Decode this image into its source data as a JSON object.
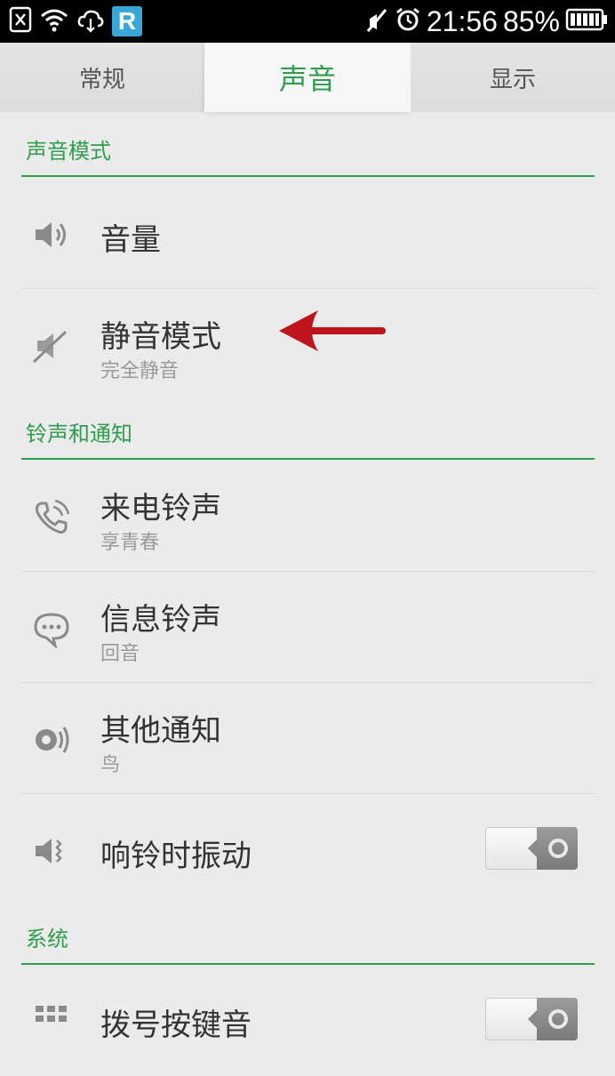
{
  "status_bar": {
    "time": "21:56",
    "battery": "85%",
    "app_badge": "R"
  },
  "tabs": [
    {
      "label": "常规",
      "active": false
    },
    {
      "label": "声音",
      "active": true
    },
    {
      "label": "显示",
      "active": false
    }
  ],
  "sections": {
    "sound_mode": "声音模式",
    "ringtones": "铃声和通知",
    "system": "系统"
  },
  "items": {
    "volume": {
      "title": "音量"
    },
    "silent": {
      "title": "静音模式",
      "subtitle": "完全静音"
    },
    "ringtone": {
      "title": "来电铃声",
      "subtitle": "享青春"
    },
    "message": {
      "title": "信息铃声",
      "subtitle": "回音"
    },
    "other": {
      "title": "其他通知",
      "subtitle": "鸟"
    },
    "vibrate": {
      "title": "响铃时振动"
    },
    "dial": {
      "title": "拨号按键音"
    }
  },
  "colors": {
    "accent": "#2e9e4e",
    "annotation_arrow": "#c0141c"
  },
  "icons": [
    "close-box-icon",
    "wifi-icon",
    "cloud-sync-icon",
    "silent-icon",
    "alarm-icon",
    "battery-icon",
    "speaker-icon",
    "muted-speaker-icon",
    "phone-ring-icon",
    "chat-bubble-icon",
    "sound-wave-icon",
    "vibrate-icon",
    "dialpad-icon"
  ]
}
